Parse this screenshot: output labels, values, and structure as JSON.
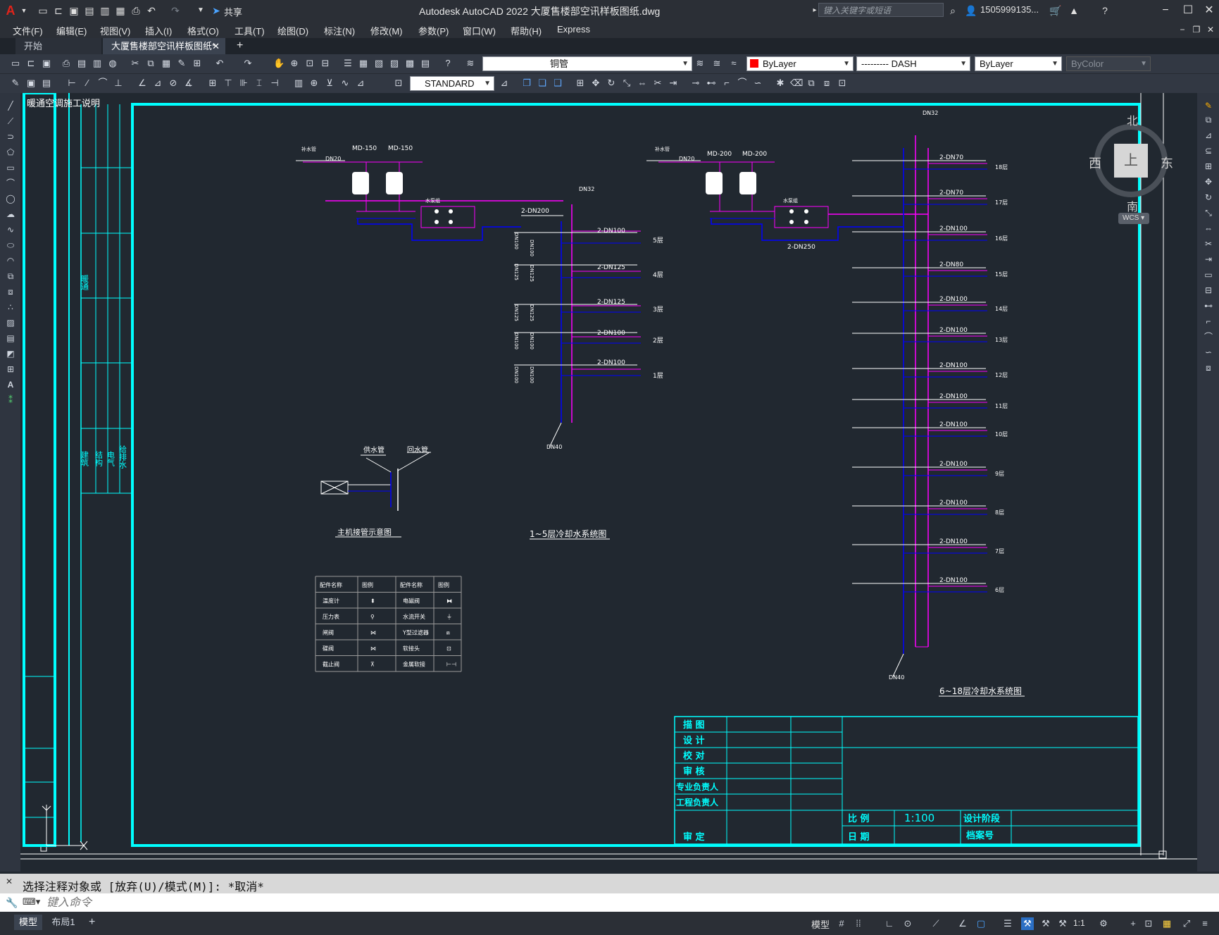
{
  "app": {
    "title": "Autodesk AutoCAD 2022    大厦售楼部空讯样板图纸.dwg",
    "share_label": "共享",
    "search_placeholder": "键入关键字或短语",
    "user": "1505999135...",
    "logo_letter": "A"
  },
  "menu": [
    "文件(F)",
    "编辑(E)",
    "视图(V)",
    "插入(I)",
    "格式(O)",
    "工具(T)",
    "绘图(D)",
    "标注(N)",
    "修改(M)",
    "参数(P)",
    "窗口(W)",
    "帮助(H)",
    "Express"
  ],
  "tabs": [
    {
      "label": "开始",
      "active": false
    },
    {
      "label": "大厦售楼部空讯样板图纸*",
      "active": true
    }
  ],
  "toolbar": {
    "layer_value": "铜管",
    "color_value": "ByLayer",
    "linetype_value": "--------- DASH",
    "lineweight_value": "ByLayer",
    "plotstyle_value": "ByColor",
    "textstyle_value": "STANDARD"
  },
  "viewcube": {
    "north": "北",
    "south": "南",
    "east": "东",
    "west": "西",
    "top": "上",
    "wcs": "WCS"
  },
  "drawing": {
    "left_title": "1~5层冷却水系统图",
    "right_title": "6~18层冷却水系统图",
    "legend_title": "主机接管示意图",
    "supply_pipe": "供水管",
    "return_pipe": "回水管",
    "left_pumps": [
      "MD-150",
      "MD-150"
    ],
    "right_pumps": [
      "MD-200",
      "MD-200"
    ],
    "left_inlet": "DN20",
    "right_inlet": "DN20",
    "left_main": "2-DN200",
    "right_main": "2-DN250",
    "vent_left": "DN32",
    "vent_right": "DN32",
    "drain_left": "DN40",
    "drain_right": "DN40",
    "left_floors": [
      {
        "pipe": "2-DN100",
        "floor": "5层"
      },
      {
        "pipe": "2-DN125",
        "floor": "4层"
      },
      {
        "pipe": "2-DN125",
        "floor": "3层"
      },
      {
        "pipe": "2-DN100",
        "floor": "2层"
      },
      {
        "pipe": "2-DN100",
        "floor": "1层"
      }
    ],
    "right_floors": [
      {
        "pipe": "2-DN70",
        "floor": "18层"
      },
      {
        "pipe": "2-DN70",
        "floor": "17层"
      },
      {
        "pipe": "2-DN100",
        "floor": "16层"
      },
      {
        "pipe": "2-DN80",
        "floor": "15层"
      },
      {
        "pipe": "2-DN100",
        "floor": "14层"
      },
      {
        "pipe": "2-DN100",
        "floor": "13层"
      },
      {
        "pipe": "2-DN100",
        "floor": "12层"
      },
      {
        "pipe": "2-DN100",
        "floor": "11层"
      },
      {
        "pipe": "2-DN100",
        "floor": "10层"
      },
      {
        "pipe": "2-DN100",
        "floor": "9层"
      },
      {
        "pipe": "2-DN100",
        "floor": "8层"
      },
      {
        "pipe": "2-DN100",
        "floor": "7层"
      },
      {
        "pipe": "2-DN100",
        "floor": "6层"
      }
    ],
    "legend_headers": [
      "配件名称",
      "图例",
      "配件名称",
      "图例"
    ],
    "legend_rows": [
      [
        "温度计",
        "⬍",
        "电磁阀",
        "⧓"
      ],
      [
        "压力表",
        "⚲",
        "水流开关",
        "⏚"
      ],
      [
        "闸阀",
        "⋈",
        "Y型过滤器",
        "⩎"
      ],
      [
        "碟阀",
        "⋈",
        "软接头",
        "⊡"
      ],
      [
        "截止阀",
        "⊼",
        "金属软接",
        "⊢⊣"
      ]
    ],
    "side_labels": [
      "暖通",
      "建筑",
      "结构",
      "电气",
      "给排水"
    ],
    "title_block_labels": [
      "描 图",
      "设 计",
      "校 对",
      "审 核",
      "专业负责人",
      "工程负责人",
      "审 定"
    ],
    "scale_label": "比 例",
    "scale_value": "1:100",
    "date_label": "日 期",
    "phase_label": "设计阶段",
    "archive_label": "档案号",
    "overlap_text": "暖通空调施工说明"
  },
  "command": {
    "history": "选择注释对象或 [放弃(U)/模式(M)]: *取消*",
    "placeholder": "键入命令"
  },
  "status": {
    "model_tab": "模型",
    "layout_tab": "布局1",
    "model_btn": "模型",
    "scale": "1:1"
  },
  "colors": {
    "cyan": "#00ffff",
    "magenta": "#ff00ff",
    "blue": "#0000ff",
    "white": "#ffffff",
    "gray": "#9a9a9a",
    "background": "#212830"
  }
}
